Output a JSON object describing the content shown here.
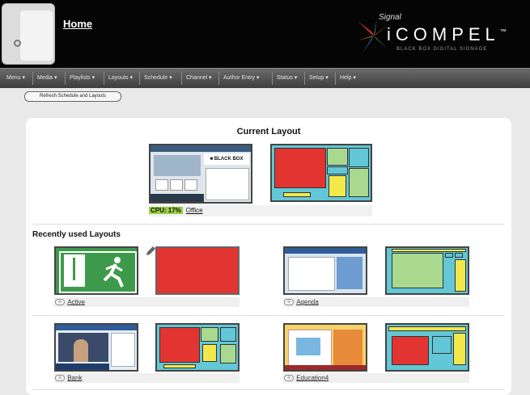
{
  "header": {
    "home_label": "Home",
    "logo_text": "iCOMPEL",
    "logo_tm": "™",
    "logo_tagline": "BLACK BOX DIGITAL SIGNAGE",
    "logo_signature": "Signal"
  },
  "menu": [
    {
      "label": "Menu ▾"
    },
    {
      "label": "Media ▾"
    },
    {
      "label": "Playlists ▾"
    },
    {
      "label": "Layouts ▾"
    },
    {
      "label": "Schedule ▾"
    },
    {
      "label": "Channel ▾"
    },
    {
      "label": "Author Entry ▾"
    },
    {
      "label": "Status ▾"
    },
    {
      "label": "Setup ▾"
    },
    {
      "label": "Help ▾"
    }
  ],
  "refresh_button": "Refresh Schedule and Layouts",
  "current": {
    "title": "Current Layout",
    "cpu_label": "CPU: 17%",
    "layout_name": "Office"
  },
  "recent": {
    "title": "Recently used Layouts",
    "items": [
      {
        "name": "Active",
        "pill": "⊙"
      },
      {
        "name": "Agenda",
        "pill": "⊙"
      },
      {
        "name": "Bank",
        "pill": "⊙"
      },
      {
        "name": "Education4",
        "pill": "⊙"
      }
    ]
  },
  "preview_text": {
    "blackbox": "■ BLACK BOX"
  },
  "colors": {
    "zone_red": "#e23531",
    "zone_cyan": "#62c7d6",
    "zone_green": "#a9d98e",
    "zone_yellow": "#f3e84b",
    "cpu_green": "#9bd045",
    "header_black": "#050505"
  }
}
